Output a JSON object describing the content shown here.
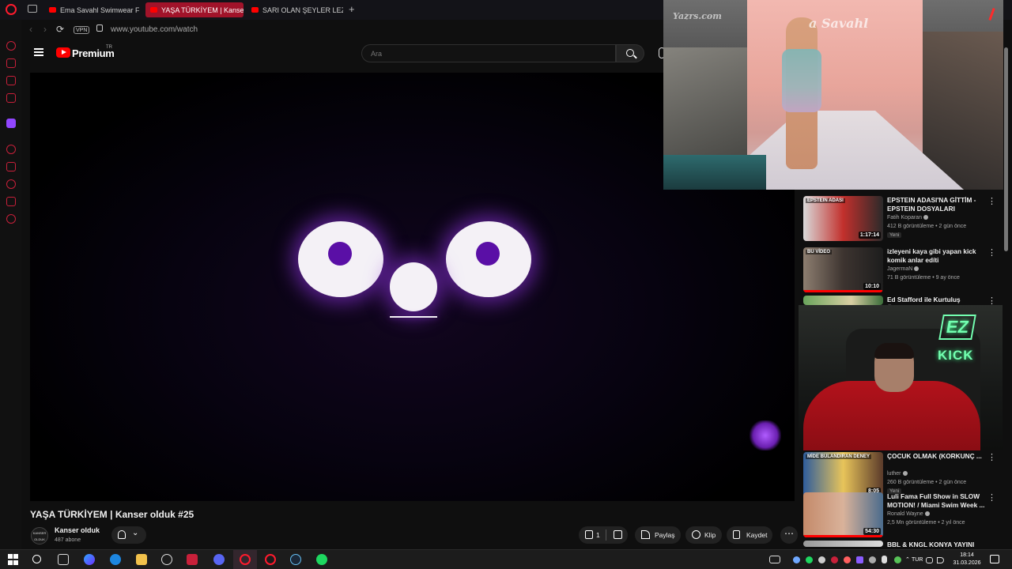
{
  "browser": {
    "tabs": [
      {
        "label": "Ema Savahl Swimwear Fa"
      },
      {
        "label": "YAŞA TÜRKİYEM | Kanse"
      },
      {
        "label": "SARI OLAN ŞEYLER LEZZE"
      }
    ],
    "vpn_label": "VPN",
    "url": "www.youtube.com/watch"
  },
  "youtube": {
    "brand": "Premium",
    "country": "TR",
    "search_placeholder": "Ara"
  },
  "video": {
    "title": "YAŞA TÜRKİYEM | Kanser olduk #25",
    "channel": "Kanser olduk",
    "subscribers": "487 abone",
    "avatar_text": "KANSER OLDUK",
    "likes": "1",
    "share_label": "Paylaş",
    "clip_label": "Klip",
    "save_label": "Kaydet"
  },
  "overlay": {
    "watermark_left": "Yazrs.com",
    "watermark_center": "a Savahl",
    "ez_text": "EZ",
    "kick_text": "KICK"
  },
  "recommendations": [
    {
      "title": "EPSTEIN ADASI'NA GİTTİM - EPSTEIN DOSYALARI",
      "channel": "Fatih Koparan",
      "meta": "412 B görüntüleme • 2 gün önce",
      "badge": "Yeni",
      "duration": "1:17:14",
      "thumb_label": "EPSTEIN ADASI",
      "progress": 0.0
    },
    {
      "title": "izleyeni kaya gibi yapan kick komik anlar edíti",
      "channel": "JagermaN",
      "meta": "71 B görüntüleme • 9 ay önce",
      "badge": "",
      "duration": "10:10",
      "thumb_label": "BU VİDEO",
      "progress": 0.99
    },
    {
      "title": "Ed Stafford ile Kurtuluş Öyküleri",
      "channel": "",
      "meta": "",
      "badge": "",
      "duration": "",
      "thumb_label": "",
      "progress": 0.0
    },
    {
      "title": "ÇOCUK OLMAK (KORKUNÇ ...",
      "channel": "luther",
      "meta": "260 B görüntüleme • 2 gün önce",
      "badge": "Yeni",
      "duration": "8:05",
      "thumb_label": "MİDE BULANDIRAN DENEY",
      "progress": 0.0
    },
    {
      "title": "Luli Fama Full Show in SLOW MOTION! / Miami Swim Week ...",
      "channel": "Ronald Wayne",
      "meta": "2,5 Mn görüntüleme • 2 yıl önce",
      "badge": "",
      "duration": "54:30",
      "thumb_label": "",
      "progress": 0.99
    },
    {
      "title": "BBL & KNGL KONYA YAYINI",
      "channel": "",
      "meta": "",
      "badge": "",
      "duration": "",
      "thumb_label": "",
      "progress": 0.0
    }
  ],
  "taskbar": {
    "lang": "TUR",
    "time": "18:14",
    "date": "31.03.2026"
  },
  "colors": {
    "accent_red": "#ff0000",
    "opera_red": "#ff1b2d",
    "eye_pupil": "#5a0fa6",
    "kick_green": "#73ffb0"
  }
}
